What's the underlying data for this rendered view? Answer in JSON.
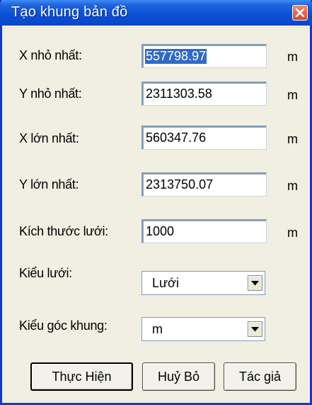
{
  "window": {
    "title": "Tạo khung bản đồ"
  },
  "fields": [
    {
      "label": "X nhỏ nhất:",
      "value": "557798.97",
      "unit": "m",
      "selected": true
    },
    {
      "label": "Y nhỏ nhất:",
      "value": "2311303.58",
      "unit": "m"
    },
    {
      "label": "X lớn nhất:",
      "value": "560347.76",
      "unit": "m"
    },
    {
      "label": "Y lớn nhất:",
      "value": "2313750.07",
      "unit": "m"
    },
    {
      "label": "Kích thước lưới:",
      "value": "1000",
      "unit": "m"
    }
  ],
  "grid_style": {
    "label": "Kiểu lưới:",
    "selected": "Lưới"
  },
  "corner_style": {
    "label": "Kiểu góc khung:",
    "selected": "m"
  },
  "buttons": {
    "execute": "Thực Hiện",
    "cancel": "Huỷ Bỏ",
    "author": "Tác giả"
  },
  "icons": {
    "close": "close-icon",
    "dropdown": "chevron-down-icon"
  },
  "colors": {
    "titlebar": "#0a4fd6",
    "window_bg": "#f1efe2",
    "selection": "#316ac5"
  }
}
